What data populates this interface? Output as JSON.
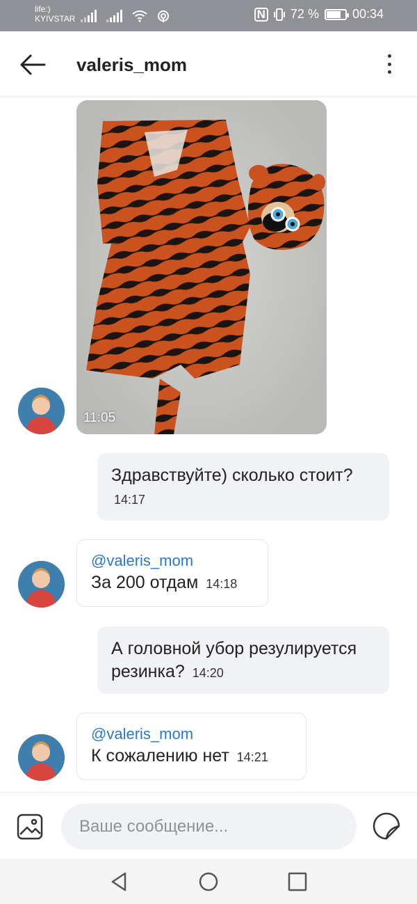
{
  "status": {
    "carrier_line1": "life:)",
    "carrier_line2": "KYIVSTAR",
    "nfc_label": "N",
    "battery_text": "72 %",
    "battery_level_percent": 72,
    "time": "00:34"
  },
  "header": {
    "title": "valeris_mom"
  },
  "messages": [
    {
      "type": "photo",
      "direction": "in",
      "time": "11:05"
    },
    {
      "type": "text",
      "direction": "out",
      "text": "Здравствуйте) сколько стоит?",
      "time": "14:17"
    },
    {
      "type": "text",
      "direction": "in",
      "mention": "@valeris_mom",
      "text": "За 200 отдам",
      "time": "14:18"
    },
    {
      "type": "text",
      "direction": "out",
      "text": "А головной убор резулируется резинка?",
      "time": "14:20"
    },
    {
      "type": "text",
      "direction": "in",
      "mention": "@valeris_mom",
      "text": "К сожалению нет",
      "time": "14:21"
    }
  ],
  "composer": {
    "placeholder": "Ваше сообщение..."
  },
  "colors": {
    "status_bar": "#8f9196",
    "mention": "#2a79c9",
    "outgoing_bubble": "#f1f2f5",
    "input_bg": "#f1f2f5"
  },
  "icons": {
    "back": "arrow-left-icon",
    "menu": "more-vertical-icon",
    "attach_image": "image-icon",
    "sticker": "sticker-icon",
    "nav_back": "triangle-back-icon",
    "nav_home": "circle-home-icon",
    "nav_recent": "square-recent-icon"
  }
}
